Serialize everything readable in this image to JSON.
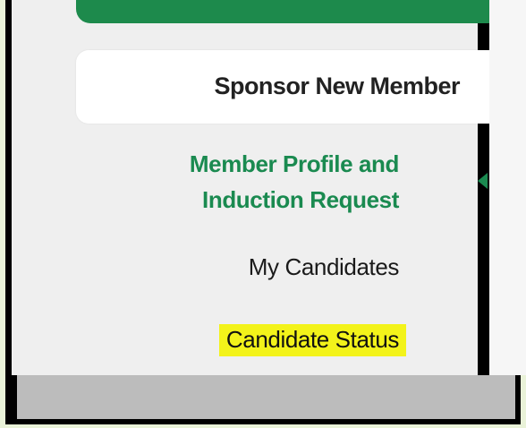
{
  "sidebar": {
    "header_label": "Sponsor New Member",
    "items": [
      {
        "label_line1": "Member Profile and",
        "label_line2": "Induction Request"
      },
      {
        "label": "My Candidates"
      },
      {
        "label": "Candidate Status"
      }
    ]
  },
  "colors": {
    "accent_green": "#1a8a50",
    "highlight_yellow": "#f3f31a",
    "bar_green": "#1d8a4c"
  },
  "icons": {
    "active_indicator": "caret-left-icon"
  }
}
